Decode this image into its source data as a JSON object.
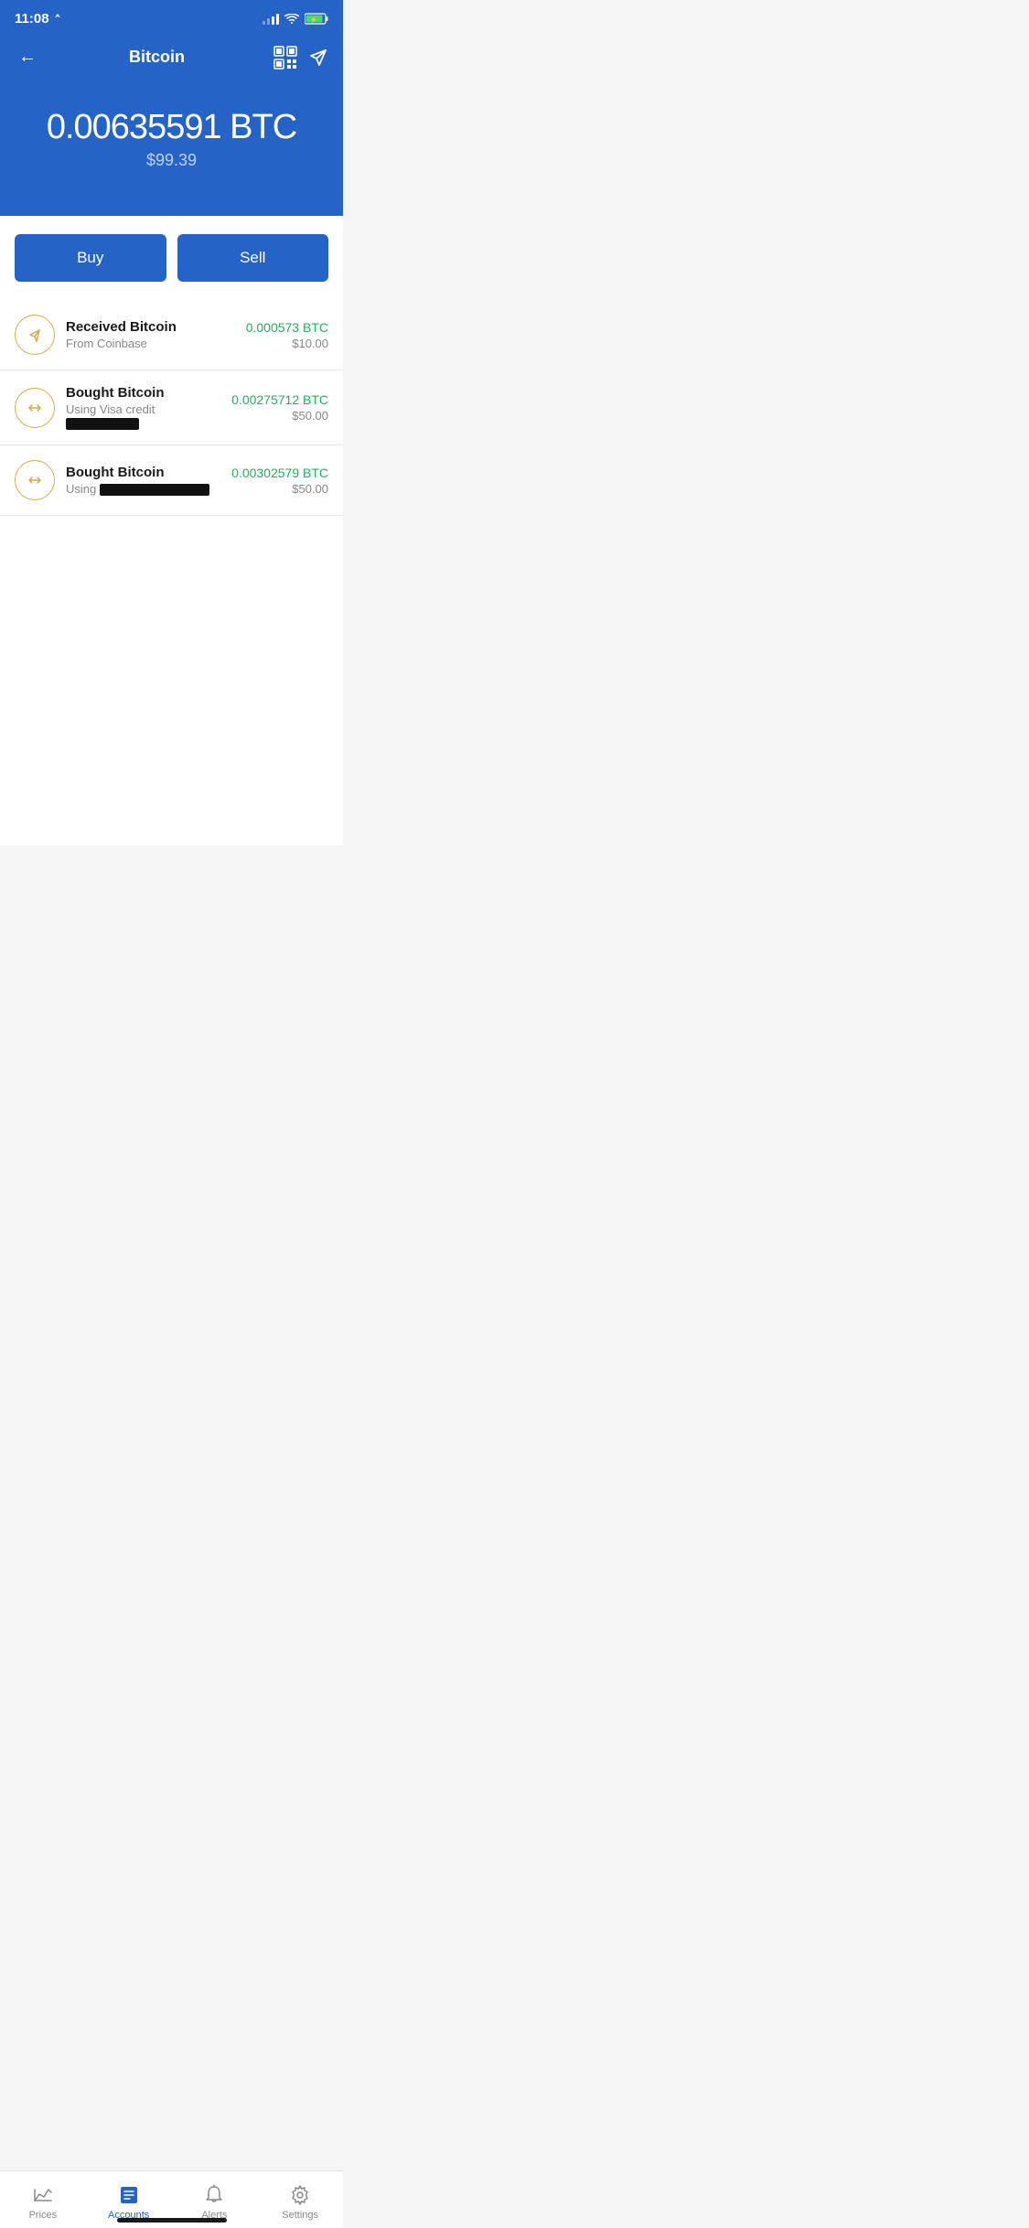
{
  "statusBar": {
    "time": "11:08",
    "locationIcon": "▶"
  },
  "header": {
    "backLabel": "←",
    "title": "Bitcoin",
    "qrLabel": "QR",
    "sendLabel": "Send"
  },
  "balance": {
    "btc": "0.00635591 BTC",
    "usd": "$99.39"
  },
  "actions": {
    "buyLabel": "Buy",
    "sellLabel": "Sell"
  },
  "transactions": [
    {
      "type": "receive",
      "title": "Received Bitcoin",
      "subtitle": "From Coinbase",
      "redacted": false,
      "btcAmount": "0.000573 BTC",
      "usdAmount": "$10.00"
    },
    {
      "type": "buy",
      "title": "Bought Bitcoin",
      "subtitle": "Using Visa credit ",
      "redacted": true,
      "btcAmount": "0.00275712 BTC",
      "usdAmount": "$50.00"
    },
    {
      "type": "buy",
      "title": "Bought Bitcoin",
      "subtitle": "Using ",
      "redacted": true,
      "btcAmount": "0.00302579 BTC",
      "usdAmount": "$50.00"
    }
  ],
  "bottomNav": [
    {
      "id": "prices",
      "label": "Prices",
      "active": false
    },
    {
      "id": "accounts",
      "label": "Accounts",
      "active": true
    },
    {
      "id": "alerts",
      "label": "Alerts",
      "active": false
    },
    {
      "id": "settings",
      "label": "Settings",
      "active": false
    }
  ]
}
